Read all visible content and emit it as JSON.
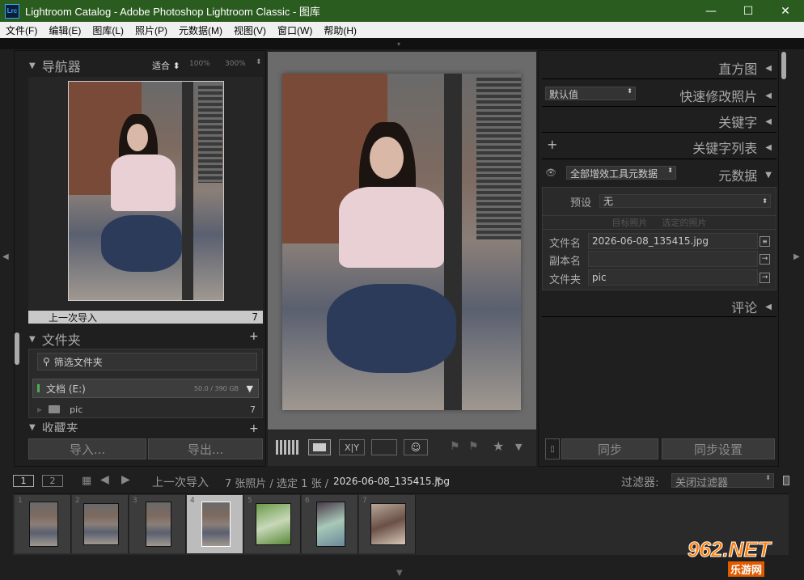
{
  "window": {
    "app_icon": "Lrc",
    "title": "Lightroom Catalog - Adobe Photoshop Lightroom Classic - 图库",
    "minimize": "—",
    "maximize": "☐",
    "close": "✕"
  },
  "menu": [
    "文件(F)",
    "编辑(E)",
    "图库(L)",
    "照片(P)",
    "元数据(M)",
    "视图(V)",
    "窗口(W)",
    "帮助(H)"
  ],
  "navigator": {
    "title": "导航器",
    "zoom": [
      "适合",
      "100%",
      "300%"
    ],
    "last_import": "上一次导入",
    "last_import_count": "7"
  },
  "folders": {
    "title": "文件夹",
    "filter_placeholder": "筛选文件夹",
    "volume": "文档 (E:)",
    "volume_size": "50.0 / 390 GB",
    "folder": "pic",
    "folder_count": "7"
  },
  "collections": {
    "title": "收藏夹"
  },
  "left_buttons": {
    "import": "导入...",
    "export": "导出..."
  },
  "right": {
    "histogram": "直方图",
    "quick_develop": "快速修改照片",
    "quick_develop_preset": "默认值",
    "keywording": "关键字",
    "keyword_list": "关键字列表",
    "metadata": "元数据",
    "metadata_preset": "全部增效工具元数据",
    "preset_label": "预设",
    "preset_value": "无",
    "target_photo": "目标照片",
    "selected_photo": "选定的照片",
    "filename_label": "文件名",
    "filename": "2026-06-08_135415.jpg",
    "copy_label": "副本名",
    "copy_value": "",
    "folder_label": "文件夹",
    "folder_value": "pic",
    "comments": "评论",
    "sync": "同步",
    "sync_settings": "同步设置"
  },
  "filmstrip_bar": {
    "page1": "1",
    "page2": "2",
    "source": "上一次导入",
    "count": "7 张照片 / 选定 1 张 /",
    "filename": "2026-06-08_135415.jpg",
    "filter_label": "过滤器:",
    "filter_value": "关闭过滤器"
  },
  "filmstrip": [
    {
      "num": "1",
      "selected": false
    },
    {
      "num": "2",
      "selected": false
    },
    {
      "num": "3",
      "selected": false
    },
    {
      "num": "4",
      "selected": true
    },
    {
      "num": "5",
      "selected": false
    },
    {
      "num": "6",
      "selected": false
    },
    {
      "num": "7",
      "selected": false
    }
  ],
  "watermark": {
    "brand": "962.NET",
    "sub": "乐游网"
  },
  "colors": {
    "titlebar": "#2b5c1f",
    "panel": "#1f1f1f",
    "center": "#6a6a6a",
    "volume_led": "#4caf50"
  }
}
